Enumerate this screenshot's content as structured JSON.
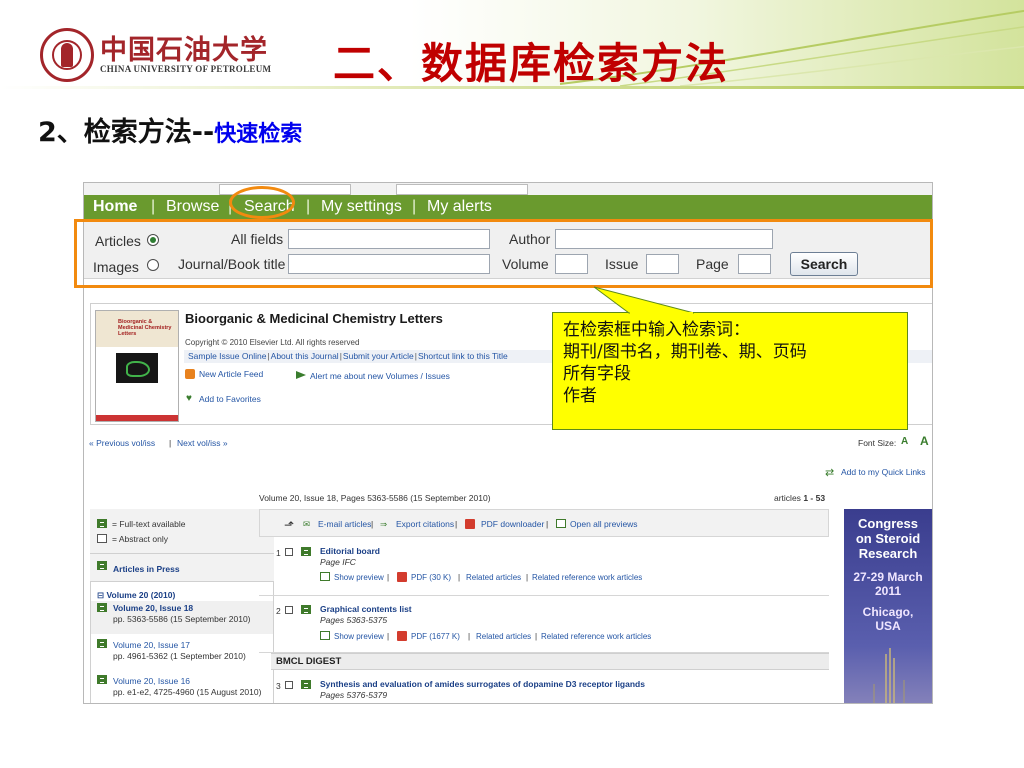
{
  "slide": {
    "university_cn": "中国石油大学",
    "university_en": "CHINA UNIVERSITY OF PETROLEUM",
    "title": "二、数据库检索方法",
    "subtitle_prefix": "2、检索方法--",
    "subtitle_highlight": "快速检索"
  },
  "nav": {
    "items": [
      "Home",
      "Browse",
      "Search",
      "My settings",
      "My alerts"
    ],
    "separator": "|"
  },
  "search": {
    "radio_articles": "Articles",
    "radio_images": "Images",
    "all_fields_label": "All fields",
    "author_label": "Author",
    "journal_label": "Journal/Book title",
    "volume_label": "Volume",
    "issue_label": "Issue",
    "page_label": "Page",
    "button": "Search",
    "all_fields_value": "",
    "author_value": "",
    "journal_value": "",
    "volume_value": "",
    "issue_value": "",
    "page_value": ""
  },
  "journal": {
    "title": "Bioorganic & Medicinal Chemistry Letters",
    "cover_label": "Bioorganic & Medicinal Chemistry Letters",
    "copyright": "Copyright © 2010 Elsevier Ltd. All rights reserved",
    "links": [
      "Sample Issue Online",
      "About this Journal",
      "Submit your Article",
      "Shortcut link to this Title"
    ],
    "new_feed": "New Article Feed",
    "alert_me": "Alert me about new Volumes / Issues",
    "favorites": "Add to Favorites"
  },
  "callout": {
    "lines": [
      "在检索框中输入检索词：",
      "期刊/图书名，期刊卷、期、页码",
      "所有字段",
      "作者"
    ]
  },
  "pager": {
    "previous": "« Previous vol/iss",
    "separator": "|",
    "next": "Next vol/iss »",
    "font_size": "Font Size:",
    "font_small": "A",
    "font_large": "A",
    "quick_links": "Add to my Quick Links"
  },
  "issue": {
    "summary": "Volume 20, Issue 18, Pages 5363-5586 (15 September 2010)",
    "articles_prefix": "articles",
    "articles_range": "1 - 53"
  },
  "legend": {
    "full_text": "= Full-text available",
    "abstract": "= Abstract only"
  },
  "sidebar": {
    "articles_in_press": "Articles in Press",
    "volume_header": "Volume 20 (2010)",
    "issues": [
      {
        "label": "Volume 20, Issue 18",
        "detail": "pp. 5363-5586 (15 September 2010)"
      },
      {
        "label": "Volume 20, Issue 17",
        "detail": "pp. 4961-5362 (1 September 2010)"
      },
      {
        "label": "Volume 20, Issue 16",
        "detail": "pp. e1-e2, 4725-4960 (15 August 2010)"
      }
    ]
  },
  "toolbar": {
    "email": "E-mail articles",
    "export": "Export citations",
    "pdf_downloader": "PDF downloader",
    "open_previews": "Open all previews"
  },
  "articles": [
    {
      "num": "1",
      "title": "Editorial board",
      "pages": "Page IFC",
      "show_preview": "Show preview",
      "pdf": "PDF (30 K)",
      "related": "Related articles",
      "related_ref": "Related reference work articles"
    },
    {
      "num": "2",
      "title": "Graphical contents list",
      "pages": "Pages 5363-5375",
      "show_preview": "Show preview",
      "pdf": "PDF (1677 K)",
      "related": "Related articles",
      "related_ref": "Related reference work articles"
    },
    {
      "num": "3",
      "title": "Synthesis and evaluation of amides surrogates of dopamine D3 receptor ligands",
      "pages": "Pages 5376-5379"
    }
  ],
  "section_digest": "BMCL DIGEST",
  "ad": {
    "lines": [
      "Congress",
      "on Steroid",
      "Research",
      "27-29 March",
      "2011",
      "Chicago,",
      "USA"
    ]
  },
  "colors": {
    "nav_green": "#6a9a2e",
    "title_red": "#c00000",
    "highlight_blue": "#0000ee",
    "callout_yellow": "#ffff00",
    "annotation_orange": "#f28a0f"
  }
}
